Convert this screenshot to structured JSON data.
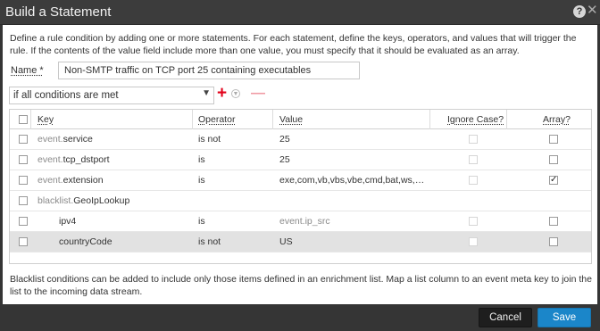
{
  "window": {
    "title": "Build a Statement",
    "help_icon": "?",
    "close_icon": "✕"
  },
  "description": "Define a rule condition by adding one or more statements. For each statement, define the keys, operators, and values that will trigger the rule. If the contents of the value field include more than one value, you must specify that it should be evaluated as an array.",
  "name_field": {
    "label": "Name *",
    "value": "Non-SMTP traffic on TCP port 25 containing executables"
  },
  "condition": {
    "selected": "if all conditions are met",
    "add_icon": "plus-icon",
    "remove_icon": "minus-icon"
  },
  "table": {
    "headers": {
      "key": "Key",
      "operator": "Operator",
      "value": "Value",
      "ignore_case": "Ignore Case?",
      "array": "Array?"
    },
    "rows": [
      {
        "key_prefix": "event.",
        "key_name": "service",
        "operator": "is not",
        "value": "25",
        "value_muted": false,
        "ignore_case": false,
        "array": false,
        "indent": false
      },
      {
        "key_prefix": "event.",
        "key_name": "tcp_dstport",
        "operator": "is",
        "value": "25",
        "value_muted": false,
        "ignore_case": false,
        "array": false,
        "indent": false
      },
      {
        "key_prefix": "event.",
        "key_name": "extension",
        "operator": "is",
        "value": "exe,com,vb,vbs,vbe,cmd,bat,ws,ws...",
        "value_muted": false,
        "ignore_case": false,
        "array": true,
        "indent": false
      },
      {
        "key_prefix": "blacklist.",
        "key_name": "GeoIpLookup",
        "operator": "",
        "value": "",
        "value_muted": false,
        "ignore_case": null,
        "array": null,
        "indent": false
      },
      {
        "key_prefix": "",
        "key_name": "ipv4",
        "operator": "is",
        "value": "event.ip_src",
        "value_muted": true,
        "ignore_case": false,
        "array": false,
        "indent": true
      },
      {
        "key_prefix": "",
        "key_name": "countryCode",
        "operator": "is not",
        "value": "US",
        "value_muted": false,
        "ignore_case": false,
        "array": false,
        "indent": true,
        "selected": true
      }
    ]
  },
  "footnote": "Blacklist conditions can be added to include only those items defined in an enrichment list. Map a list column to an event meta key to join the list to the incoming data stream.",
  "buttons": {
    "cancel": "Cancel",
    "save": "Save"
  },
  "colors": {
    "accent": "#1b86c9",
    "add": "#e2001a",
    "remove": "#f09aa3",
    "titlebar": "#3c3c3c"
  }
}
